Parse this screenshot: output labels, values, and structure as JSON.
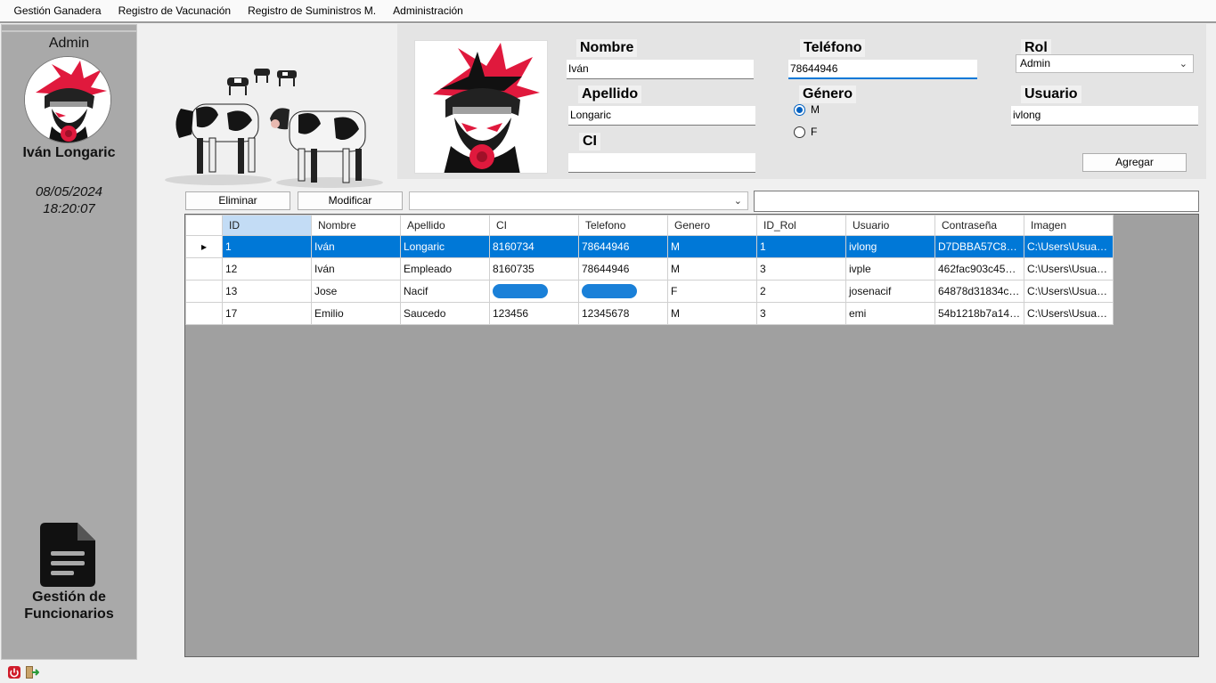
{
  "menu": [
    "Gestión Ganadera",
    "Registro de Vacunación",
    "Registro de Suministros M.",
    "Administración"
  ],
  "sidebar": {
    "role": "Admin",
    "user_name": "Iván Longaric",
    "date": "08/05/2024",
    "time": "18:20:07",
    "module_label_line1": "Gestión de",
    "module_label_line2": "Funcionarios",
    "module_icon": "document-icon"
  },
  "form": {
    "nombre_label": "Nombre",
    "nombre_value": "Iván",
    "apellido_label": "Apellido",
    "apellido_value": "Longaric",
    "ci_label": "CI",
    "ci_value": "",
    "telefono_label": "Teléfono",
    "telefono_value": "78644946",
    "genero_label": "Género",
    "genero_options": [
      "M",
      "F"
    ],
    "genero_selected": "M",
    "rol_label": "Rol",
    "rol_value": "Admin",
    "usuario_label": "Usuario",
    "usuario_value": "ivlong",
    "agregar_button": "Agregar"
  },
  "toolbar": {
    "eliminar_button": "Eliminar",
    "modificar_button": "Modificar",
    "filter_select_value": "",
    "search_value": ""
  },
  "table": {
    "columns": [
      "ID",
      "Nombre",
      "Apellido",
      "CI",
      "Telefono",
      "Genero",
      "ID_Rol",
      "Usuario",
      "Contraseña",
      "Imagen"
    ],
    "rows": [
      [
        "1",
        "Iván",
        "Longaric",
        "8160734",
        "78644946",
        "M",
        "1",
        "ivlong",
        "D7DBBA57C8B...",
        "C:\\Users\\Usuari..."
      ],
      [
        "12",
        "Iván",
        "Empleado",
        "8160735",
        "78644946",
        "M",
        "3",
        "ivple",
        "462fac903c45b0...",
        "C:\\Users\\Usuari..."
      ],
      [
        "13",
        "Jose",
        "Nacif",
        "",
        "",
        "F",
        "2",
        "josenacif",
        "64878d31834c3...",
        "C:\\Users\\Usuari..."
      ],
      [
        "17",
        "Emilio",
        "Saucedo",
        "123456",
        "12345678",
        "M",
        "3",
        "emi",
        "54b1218b7a142...",
        "C:\\Users\\Usuari..."
      ]
    ],
    "selected_row": 0
  },
  "colors": {
    "selection": "#0078d7",
    "sidebar_bg": "#a9a9a9",
    "grid_bg": "#a0a0a0",
    "avatar_accent": "#e0193d"
  },
  "status_icons": [
    "power-icon",
    "exit-icon"
  ]
}
